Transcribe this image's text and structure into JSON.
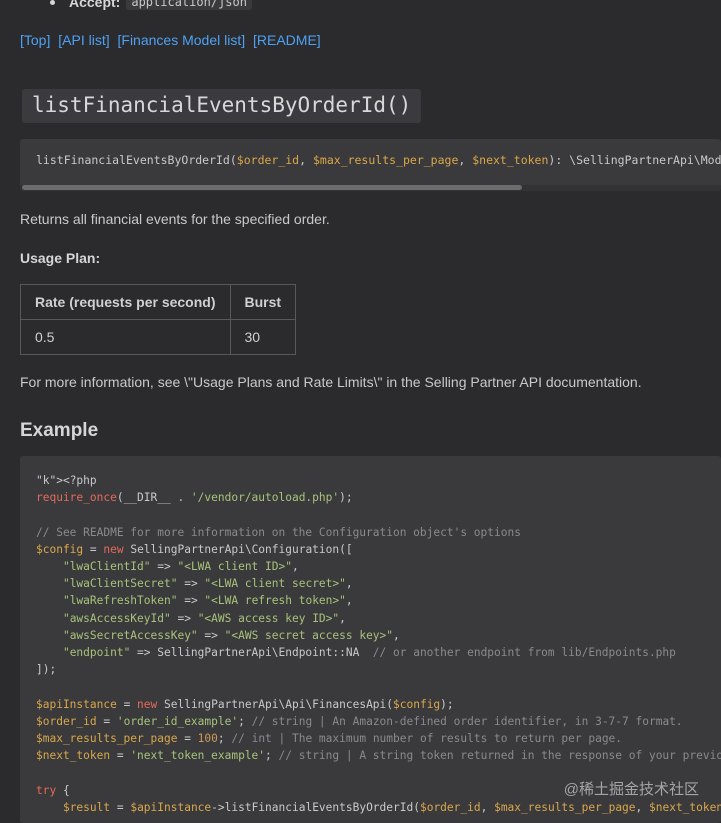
{
  "accept": {
    "key": "Accept:",
    "value": "application/json"
  },
  "nav": {
    "top": "[Top]",
    "api_list": "[API list]",
    "model_list": "[Finances Model list]",
    "readme": "[README]"
  },
  "method": {
    "title": "listFinancialEventsByOrderId()",
    "signature": "listFinancialEventsByOrderId($order_id, $max_results_per_page, $next_token): \\SellingPartnerApi\\Model\\"
  },
  "description": "Returns all financial events for the specified order.",
  "usage_plan": {
    "label": "Usage Plan:",
    "headers": [
      "Rate (requests per second)",
      "Burst"
    ],
    "row": [
      "0.5",
      "30"
    ]
  },
  "more_info": "For more information, see \\\"Usage Plans and Rate Limits\\\" in the Selling Partner API documentation.",
  "example_heading": "Example",
  "code_lines": [
    "<?php",
    "require_once(__DIR__ . '/vendor/autoload.php');",
    "",
    "// See README for more information on the Configuration object's options",
    "$config = new SellingPartnerApi\\Configuration([",
    "    \"lwaClientId\" => \"<LWA client ID>\",",
    "    \"lwaClientSecret\" => \"<LWA client secret>\",",
    "    \"lwaRefreshToken\" => \"<LWA refresh token>\",",
    "    \"awsAccessKeyId\" => \"<AWS access key ID>\",",
    "    \"awsSecretAccessKey\" => \"<AWS secret access key>\",",
    "    \"endpoint\" => SellingPartnerApi\\Endpoint::NA  // or another endpoint from lib/Endpoints.php",
    "]);",
    "",
    "$apiInstance = new SellingPartnerApi\\Api\\FinancesApi($config);",
    "$order_id = 'order_id_example'; // string | An Amazon-defined order identifier, in 3-7-7 format.",
    "$max_results_per_page = 100; // int | The maximum number of results to return per page.",
    "$next_token = 'next_token_example'; // string | A string token returned in the response of your previo",
    "",
    "try {",
    "    $result = $apiInstance->listFinancialEventsByOrderId($order_id, $max_results_per_page, $next_token"
  ],
  "watermark": "@稀土掘金技术社区"
}
